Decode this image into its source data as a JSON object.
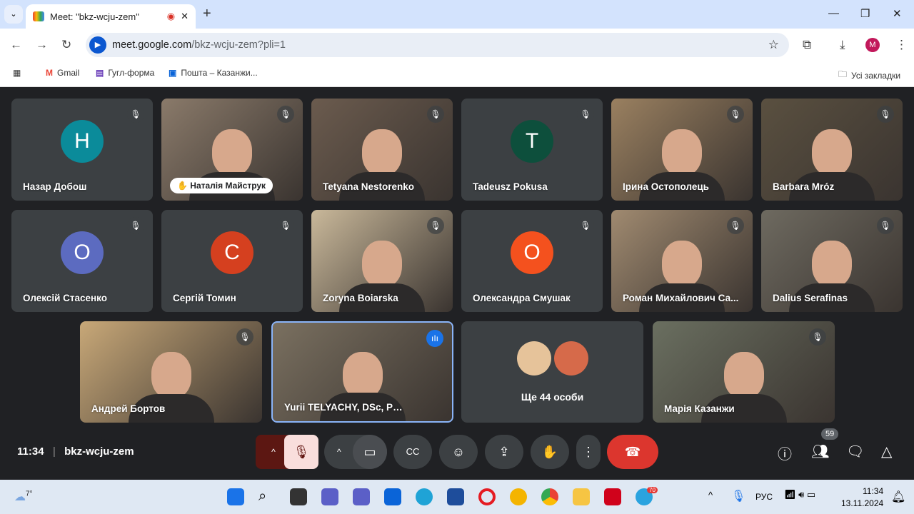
{
  "browser": {
    "tab_title": "Meet: \"bkz-wcju-zem\"",
    "url_host": "meet.google.com",
    "url_path": "/bkz-wcju-zem?pli=1",
    "bookmarks": [
      "Gmail",
      "Гугл-форма",
      "Пошта – Казанжи..."
    ],
    "all_bookmarks": "Усі закладки",
    "profile_initial": "M"
  },
  "tiles": [
    {
      "name": "Назар Добош",
      "initial": "Н",
      "color": "#0b8b9a"
    },
    {
      "name": "Наталія Майструк",
      "video": true
    },
    {
      "name": "Tetyana Nestorenko",
      "video": true
    },
    {
      "name": "Tadeusz Pokusa",
      "initial": "T",
      "color": "#0d4f3c"
    },
    {
      "name": "Ірина Остополець",
      "video": true
    },
    {
      "name": "Barbara Mróz",
      "video": true
    },
    {
      "name": "Олексій Стасенко",
      "initial": "О",
      "color": "#5c6bc0"
    },
    {
      "name": "Сергій Томин",
      "initial": "С",
      "color": "#d5401f"
    },
    {
      "name": "Zoryna Boiarska",
      "video": true
    },
    {
      "name": "Олександра Смушак",
      "initial": "О",
      "color": "#f4511e"
    },
    {
      "name": "Роман Михайлович Са...",
      "video": true
    },
    {
      "name": "Dalius Serafinas",
      "video": true
    },
    {
      "name": "Андрей Бортов",
      "video": true
    },
    {
      "name": "Yurii TELYACHY, DSc, Professor",
      "video": true,
      "speaking": true
    },
    {
      "name": "Ще 44 особи",
      "others": true
    },
    {
      "name": "Марія Казанжи",
      "video": true
    }
  ],
  "meeting": {
    "time": "11:34",
    "code": "bkz-wcju-zem",
    "participants_count": "59"
  },
  "taskbar": {
    "weather": "7°",
    "lang": "РУС",
    "clock_time": "11:34",
    "clock_date": "13.11.2024",
    "telegram_badge": "70"
  }
}
